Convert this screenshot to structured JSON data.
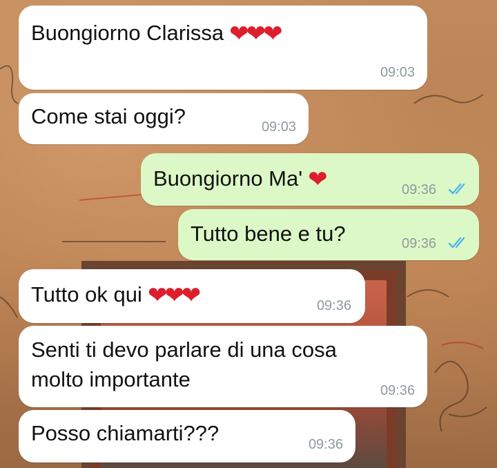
{
  "colors": {
    "incoming_bubble": "#ffffff",
    "outgoing_bubble": "#dcf8c6",
    "read_ticks": "#4fb6ec",
    "heart": "#dd1f2d",
    "timestamp": "#8f9a9f"
  },
  "messages": [
    {
      "direction": "incoming",
      "text": "Buongiorno Clarissa",
      "emoji": "❤❤❤",
      "time": "09:03"
    },
    {
      "direction": "incoming",
      "text": "Come stai oggi?",
      "time": "09:03"
    },
    {
      "direction": "outgoing",
      "text": "Buongiorno Ma'",
      "emoji": "❤",
      "time": "09:36",
      "status_icon": "double-check-read"
    },
    {
      "direction": "outgoing",
      "text": "Tutto bene e tu?",
      "time": "09:36",
      "status_icon": "double-check-read"
    },
    {
      "direction": "incoming",
      "text": "Tutto ok qui",
      "emoji": "❤❤❤",
      "time": "09:36"
    },
    {
      "direction": "incoming",
      "text_line1": "Senti ti devo parlare di una cosa",
      "text_line2": "molto importante",
      "time": "09:36"
    },
    {
      "direction": "incoming",
      "text": "Posso chiamarti???",
      "time": "09:36"
    }
  ]
}
